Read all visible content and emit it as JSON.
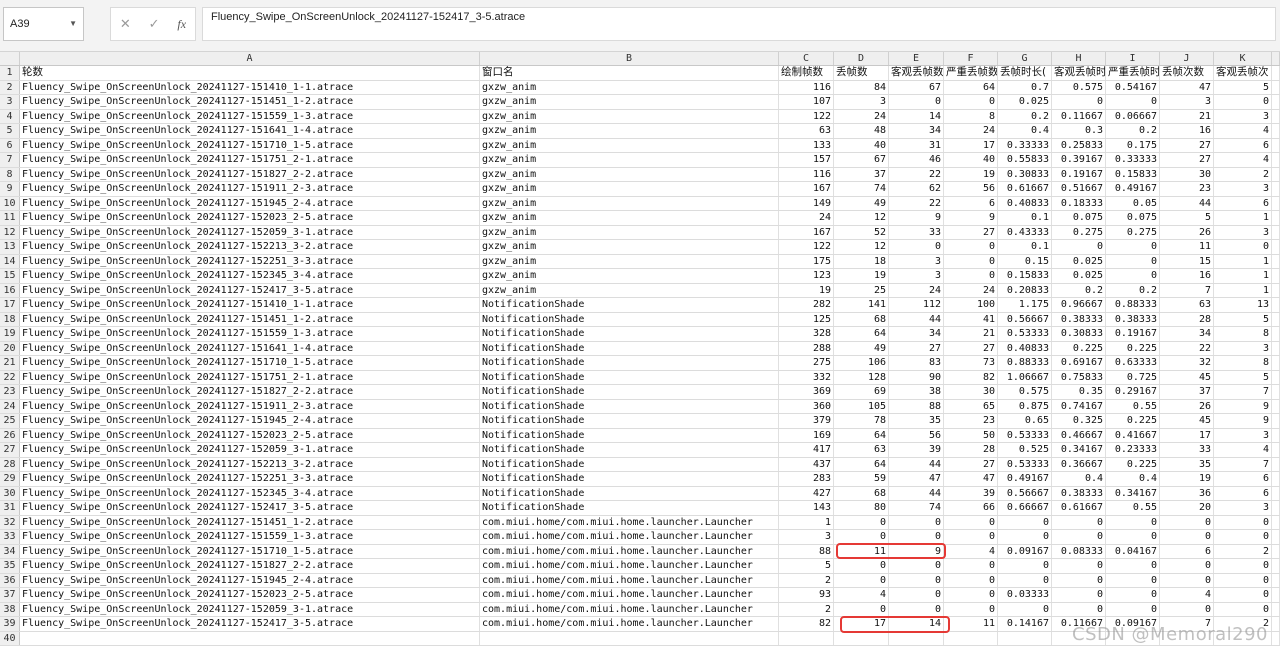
{
  "formula_bar": {
    "name_box": "A39",
    "cancel_icon": "close-icon",
    "confirm_icon": "check-icon",
    "fx_label": "fx",
    "formula_text": "Fluency_Swipe_OnScreenUnlock_20241127-152417_3-5.atrace"
  },
  "columns": [
    "A",
    "B",
    "C",
    "D",
    "E",
    "F",
    "G",
    "H",
    "I",
    "J",
    "K"
  ],
  "header_row": [
    "轮数",
    "窗口名",
    "绘制帧数",
    "丢帧数",
    "客观丢帧数",
    "严重丢帧数",
    "丢帧时长(",
    "客观丢帧时",
    "严重丢帧时",
    "丢帧次数",
    "客观丢帧次"
  ],
  "rows": [
    [
      "Fluency_Swipe_OnScreenUnlock_20241127-151410_1-1.atrace",
      "gxzw_anim",
      "116",
      "84",
      "67",
      "64",
      "0.7",
      "0.575",
      "0.54167",
      "47",
      "5"
    ],
    [
      "Fluency_Swipe_OnScreenUnlock_20241127-151451_1-2.atrace",
      "gxzw_anim",
      "107",
      "3",
      "0",
      "0",
      "0.025",
      "0",
      "0",
      "3",
      "0"
    ],
    [
      "Fluency_Swipe_OnScreenUnlock_20241127-151559_1-3.atrace",
      "gxzw_anim",
      "122",
      "24",
      "14",
      "8",
      "0.2",
      "0.11667",
      "0.06667",
      "21",
      "3"
    ],
    [
      "Fluency_Swipe_OnScreenUnlock_20241127-151641_1-4.atrace",
      "gxzw_anim",
      "63",
      "48",
      "34",
      "24",
      "0.4",
      "0.3",
      "0.2",
      "16",
      "4"
    ],
    [
      "Fluency_Swipe_OnScreenUnlock_20241127-151710_1-5.atrace",
      "gxzw_anim",
      "133",
      "40",
      "31",
      "17",
      "0.33333",
      "0.25833",
      "0.175",
      "27",
      "6"
    ],
    [
      "Fluency_Swipe_OnScreenUnlock_20241127-151751_2-1.atrace",
      "gxzw_anim",
      "157",
      "67",
      "46",
      "40",
      "0.55833",
      "0.39167",
      "0.33333",
      "27",
      "4"
    ],
    [
      "Fluency_Swipe_OnScreenUnlock_20241127-151827_2-2.atrace",
      "gxzw_anim",
      "116",
      "37",
      "22",
      "19",
      "0.30833",
      "0.19167",
      "0.15833",
      "30",
      "2"
    ],
    [
      "Fluency_Swipe_OnScreenUnlock_20241127-151911_2-3.atrace",
      "gxzw_anim",
      "167",
      "74",
      "62",
      "56",
      "0.61667",
      "0.51667",
      "0.49167",
      "23",
      "3"
    ],
    [
      "Fluency_Swipe_OnScreenUnlock_20241127-151945_2-4.atrace",
      "gxzw_anim",
      "149",
      "49",
      "22",
      "6",
      "0.40833",
      "0.18333",
      "0.05",
      "44",
      "6"
    ],
    [
      "Fluency_Swipe_OnScreenUnlock_20241127-152023_2-5.atrace",
      "gxzw_anim",
      "24",
      "12",
      "9",
      "9",
      "0.1",
      "0.075",
      "0.075",
      "5",
      "1"
    ],
    [
      "Fluency_Swipe_OnScreenUnlock_20241127-152059_3-1.atrace",
      "gxzw_anim",
      "167",
      "52",
      "33",
      "27",
      "0.43333",
      "0.275",
      "0.275",
      "26",
      "3"
    ],
    [
      "Fluency_Swipe_OnScreenUnlock_20241127-152213_3-2.atrace",
      "gxzw_anim",
      "122",
      "12",
      "0",
      "0",
      "0.1",
      "0",
      "0",
      "11",
      "0"
    ],
    [
      "Fluency_Swipe_OnScreenUnlock_20241127-152251_3-3.atrace",
      "gxzw_anim",
      "175",
      "18",
      "3",
      "0",
      "0.15",
      "0.025",
      "0",
      "15",
      "1"
    ],
    [
      "Fluency_Swipe_OnScreenUnlock_20241127-152345_3-4.atrace",
      "gxzw_anim",
      "123",
      "19",
      "3",
      "0",
      "0.15833",
      "0.025",
      "0",
      "16",
      "1"
    ],
    [
      "Fluency_Swipe_OnScreenUnlock_20241127-152417_3-5.atrace",
      "gxzw_anim",
      "19",
      "25",
      "24",
      "24",
      "0.20833",
      "0.2",
      "0.2",
      "7",
      "1"
    ],
    [
      "Fluency_Swipe_OnScreenUnlock_20241127-151410_1-1.atrace",
      "NotificationShade",
      "282",
      "141",
      "112",
      "100",
      "1.175",
      "0.96667",
      "0.88333",
      "63",
      "13"
    ],
    [
      "Fluency_Swipe_OnScreenUnlock_20241127-151451_1-2.atrace",
      "NotificationShade",
      "125",
      "68",
      "44",
      "41",
      "0.56667",
      "0.38333",
      "0.38333",
      "28",
      "5"
    ],
    [
      "Fluency_Swipe_OnScreenUnlock_20241127-151559_1-3.atrace",
      "NotificationShade",
      "328",
      "64",
      "34",
      "21",
      "0.53333",
      "0.30833",
      "0.19167",
      "34",
      "8"
    ],
    [
      "Fluency_Swipe_OnScreenUnlock_20241127-151641_1-4.atrace",
      "NotificationShade",
      "288",
      "49",
      "27",
      "27",
      "0.40833",
      "0.225",
      "0.225",
      "22",
      "3"
    ],
    [
      "Fluency_Swipe_OnScreenUnlock_20241127-151710_1-5.atrace",
      "NotificationShade",
      "275",
      "106",
      "83",
      "73",
      "0.88333",
      "0.69167",
      "0.63333",
      "32",
      "8"
    ],
    [
      "Fluency_Swipe_OnScreenUnlock_20241127-151751_2-1.atrace",
      "NotificationShade",
      "332",
      "128",
      "90",
      "82",
      "1.06667",
      "0.75833",
      "0.725",
      "45",
      "5"
    ],
    [
      "Fluency_Swipe_OnScreenUnlock_20241127-151827_2-2.atrace",
      "NotificationShade",
      "369",
      "69",
      "38",
      "30",
      "0.575",
      "0.35",
      "0.29167",
      "37",
      "7"
    ],
    [
      "Fluency_Swipe_OnScreenUnlock_20241127-151911_2-3.atrace",
      "NotificationShade",
      "360",
      "105",
      "88",
      "65",
      "0.875",
      "0.74167",
      "0.55",
      "26",
      "9"
    ],
    [
      "Fluency_Swipe_OnScreenUnlock_20241127-151945_2-4.atrace",
      "NotificationShade",
      "379",
      "78",
      "35",
      "23",
      "0.65",
      "0.325",
      "0.225",
      "45",
      "9"
    ],
    [
      "Fluency_Swipe_OnScreenUnlock_20241127-152023_2-5.atrace",
      "NotificationShade",
      "169",
      "64",
      "56",
      "50",
      "0.53333",
      "0.46667",
      "0.41667",
      "17",
      "3"
    ],
    [
      "Fluency_Swipe_OnScreenUnlock_20241127-152059_3-1.atrace",
      "NotificationShade",
      "417",
      "63",
      "39",
      "28",
      "0.525",
      "0.34167",
      "0.23333",
      "33",
      "4"
    ],
    [
      "Fluency_Swipe_OnScreenUnlock_20241127-152213_3-2.atrace",
      "NotificationShade",
      "437",
      "64",
      "44",
      "27",
      "0.53333",
      "0.36667",
      "0.225",
      "35",
      "7"
    ],
    [
      "Fluency_Swipe_OnScreenUnlock_20241127-152251_3-3.atrace",
      "NotificationShade",
      "283",
      "59",
      "47",
      "47",
      "0.49167",
      "0.4",
      "0.4",
      "19",
      "6"
    ],
    [
      "Fluency_Swipe_OnScreenUnlock_20241127-152345_3-4.atrace",
      "NotificationShade",
      "427",
      "68",
      "44",
      "39",
      "0.56667",
      "0.38333",
      "0.34167",
      "36",
      "6"
    ],
    [
      "Fluency_Swipe_OnScreenUnlock_20241127-152417_3-5.atrace",
      "NotificationShade",
      "143",
      "80",
      "74",
      "66",
      "0.66667",
      "0.61667",
      "0.55",
      "20",
      "3"
    ],
    [
      "Fluency_Swipe_OnScreenUnlock_20241127-151451_1-2.atrace",
      "com.miui.home/com.miui.home.launcher.Launcher",
      "1",
      "0",
      "0",
      "0",
      "0",
      "0",
      "0",
      "0",
      "0"
    ],
    [
      "Fluency_Swipe_OnScreenUnlock_20241127-151559_1-3.atrace",
      "com.miui.home/com.miui.home.launcher.Launcher",
      "3",
      "0",
      "0",
      "0",
      "0",
      "0",
      "0",
      "0",
      "0"
    ],
    [
      "Fluency_Swipe_OnScreenUnlock_20241127-151710_1-5.atrace",
      "com.miui.home/com.miui.home.launcher.Launcher",
      "88",
      "11",
      "9",
      "4",
      "0.09167",
      "0.08333",
      "0.04167",
      "6",
      "2"
    ],
    [
      "Fluency_Swipe_OnScreenUnlock_20241127-151827_2-2.atrace",
      "com.miui.home/com.miui.home.launcher.Launcher",
      "5",
      "0",
      "0",
      "0",
      "0",
      "0",
      "0",
      "0",
      "0"
    ],
    [
      "Fluency_Swipe_OnScreenUnlock_20241127-151945_2-4.atrace",
      "com.miui.home/com.miui.home.launcher.Launcher",
      "2",
      "0",
      "0",
      "0",
      "0",
      "0",
      "0",
      "0",
      "0"
    ],
    [
      "Fluency_Swipe_OnScreenUnlock_20241127-152023_2-5.atrace",
      "com.miui.home/com.miui.home.launcher.Launcher",
      "93",
      "4",
      "0",
      "0",
      "0.03333",
      "0",
      "0",
      "4",
      "0"
    ],
    [
      "Fluency_Swipe_OnScreenUnlock_20241127-152059_3-1.atrace",
      "com.miui.home/com.miui.home.launcher.Launcher",
      "2",
      "0",
      "0",
      "0",
      "0",
      "0",
      "0",
      "0",
      "0"
    ],
    [
      "Fluency_Swipe_OnScreenUnlock_20241127-152417_3-5.atrace",
      "com.miui.home/com.miui.home.launcher.Launcher",
      "82",
      "17",
      "14",
      "11",
      "0.14167",
      "0.11667",
      "0.09167",
      "7",
      "2"
    ],
    [
      "",
      "",
      "",
      "",
      "",
      "",
      "",
      "",
      "",
      "",
      ""
    ]
  ],
  "highlight_color": "#e53935",
  "watermark": "CSDN @Memoral290"
}
